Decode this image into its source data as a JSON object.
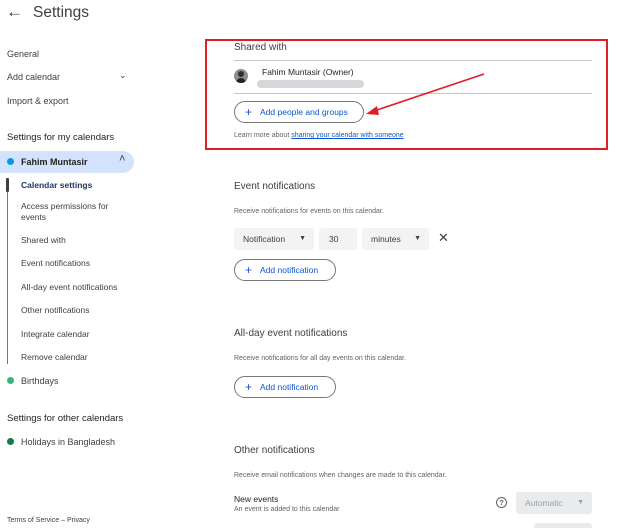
{
  "header": {
    "title": "Settings",
    "back_icon": "back-arrow-icon"
  },
  "sidebar": {
    "general": "General",
    "add_calendar": "Add calendar",
    "import_export": "Import & export",
    "my_calendars_heading": "Settings for my calendars",
    "my_calendar": {
      "name": "Fahim Muntasir",
      "color": "#039be5"
    },
    "subitems": [
      "Calendar settings",
      "Access permissions for events",
      "Shared with",
      "Event notifications",
      "All-day event notifications",
      "Other notifications",
      "Integrate calendar",
      "Remove calendar"
    ],
    "birthdays": {
      "name": "Birthdays",
      "color": "#33b679"
    },
    "other_calendars_heading": "Settings for other calendars",
    "holidays": {
      "name": "Holidays in Bangladesh",
      "color": "#0b8043"
    }
  },
  "shared_with": {
    "title": "Shared with",
    "owner": "Fahim Muntasir (Owner)",
    "add_button": "Add people and groups",
    "learn_prefix": "Learn more about ",
    "learn_link": "sharing your calendar with someone"
  },
  "event_notifications": {
    "title": "Event notifications",
    "desc": "Receive notifications for events on this calendar.",
    "type": "Notification",
    "amount": "30",
    "unit": "minutes",
    "add_button": "Add notification"
  },
  "allday_notifications": {
    "title": "All-day event notifications",
    "desc": "Receive notifications for all day events on this calendar.",
    "add_button": "Add notification"
  },
  "other_notifications": {
    "title": "Other notifications",
    "desc": "Receive email notifications when changes are made to this calendar.",
    "new_events_title": "New events",
    "new_events_desc": "An event is added to this calendar",
    "new_events_value": "Automatic"
  },
  "footer": {
    "terms": "Terms of Service",
    "separator": "–",
    "privacy": "Privacy"
  },
  "colors": {
    "accent": "#0b57d0",
    "highlight": "#d3e3fd",
    "annotation": "#e11d27"
  }
}
